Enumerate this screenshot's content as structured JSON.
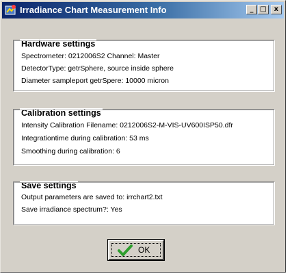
{
  "window": {
    "title": "Irradiance Chart Measurement Info",
    "controls": {
      "minimize": "_",
      "maximize": "□",
      "close": "x"
    }
  },
  "hardware": {
    "heading": "Hardware settings",
    "lines": [
      "Spectrometer: 0212006S2  Channel: Master",
      "DetectorType: getrSphere, source inside sphere",
      "Diameter sampleport getrSpere: 10000 micron"
    ]
  },
  "calibration": {
    "heading": "Calibration settings",
    "lines": [
      "Intensity Calibration Filename: 0212006S2-M-VIS-UV600ISP50.dfr",
      "Integrationtime during calibration: 53 ms",
      "Smoothing during calibration: 6"
    ]
  },
  "save": {
    "heading": "Save settings",
    "lines": [
      "Output parameters are saved to: irrchart2.txt",
      "Save irradiance spectrum?: Yes"
    ]
  },
  "ok_button": {
    "label": "OK"
  },
  "colors": {
    "title_start": "#0a246a",
    "title_end": "#a6caf0",
    "face": "#d4d0c8",
    "check": "#2e9e2e"
  },
  "icons": {
    "app": "app-icon",
    "ok": "checkmark-icon"
  }
}
